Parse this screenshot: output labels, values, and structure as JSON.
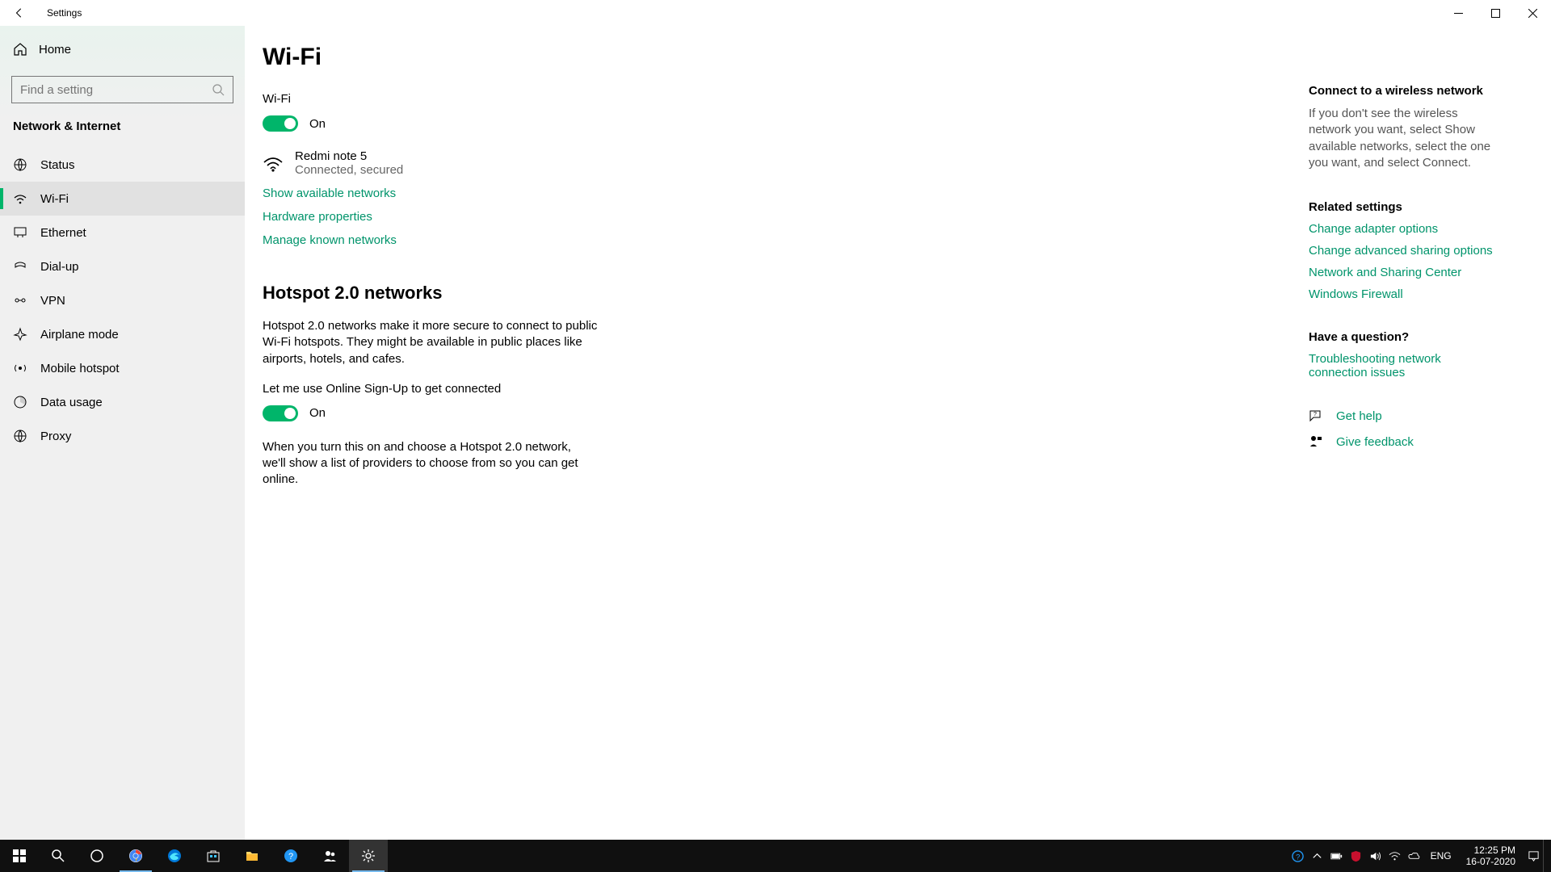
{
  "titlebar": {
    "title": "Settings"
  },
  "sidebar": {
    "home_label": "Home",
    "search_placeholder": "Find a setting",
    "category": "Network & Internet",
    "items": [
      {
        "label": "Status"
      },
      {
        "label": "Wi-Fi"
      },
      {
        "label": "Ethernet"
      },
      {
        "label": "Dial-up"
      },
      {
        "label": "VPN"
      },
      {
        "label": "Airplane mode"
      },
      {
        "label": "Mobile hotspot"
      },
      {
        "label": "Data usage"
      },
      {
        "label": "Proxy"
      }
    ]
  },
  "main": {
    "page_title": "Wi-Fi",
    "wifi_label": "Wi-Fi",
    "wifi_state": "On",
    "network_name": "Redmi note 5",
    "network_status": "Connected, secured",
    "link_show_networks": "Show available networks",
    "link_hardware": "Hardware properties",
    "link_manage": "Manage known networks",
    "hotspot_heading": "Hotspot 2.0 networks",
    "hotspot_para": "Hotspot 2.0 networks make it more secure to connect to public Wi-Fi hotspots. They might be available in public places like airports, hotels, and cafes.",
    "signup_label": "Let me use Online Sign-Up to get connected",
    "signup_state": "On",
    "signup_para": "When you turn this on and choose a Hotspot 2.0 network, we'll show a list of providers to choose from so you can get online."
  },
  "aside": {
    "connect_heading": "Connect to a wireless network",
    "connect_para": "If you don't see the wireless network you want, select Show available networks, select the one you want, and select Connect.",
    "related_heading": "Related settings",
    "link_adapter": "Change adapter options",
    "link_sharing": "Change advanced sharing options",
    "link_center": "Network and Sharing Center",
    "link_firewall": "Windows Firewall",
    "question_heading": "Have a question?",
    "link_trouble": "Troubleshooting network connection issues",
    "link_help": "Get help",
    "link_feedback": "Give feedback"
  },
  "taskbar": {
    "lang": "ENG",
    "time": "12:25 PM",
    "date": "16-07-2020"
  }
}
